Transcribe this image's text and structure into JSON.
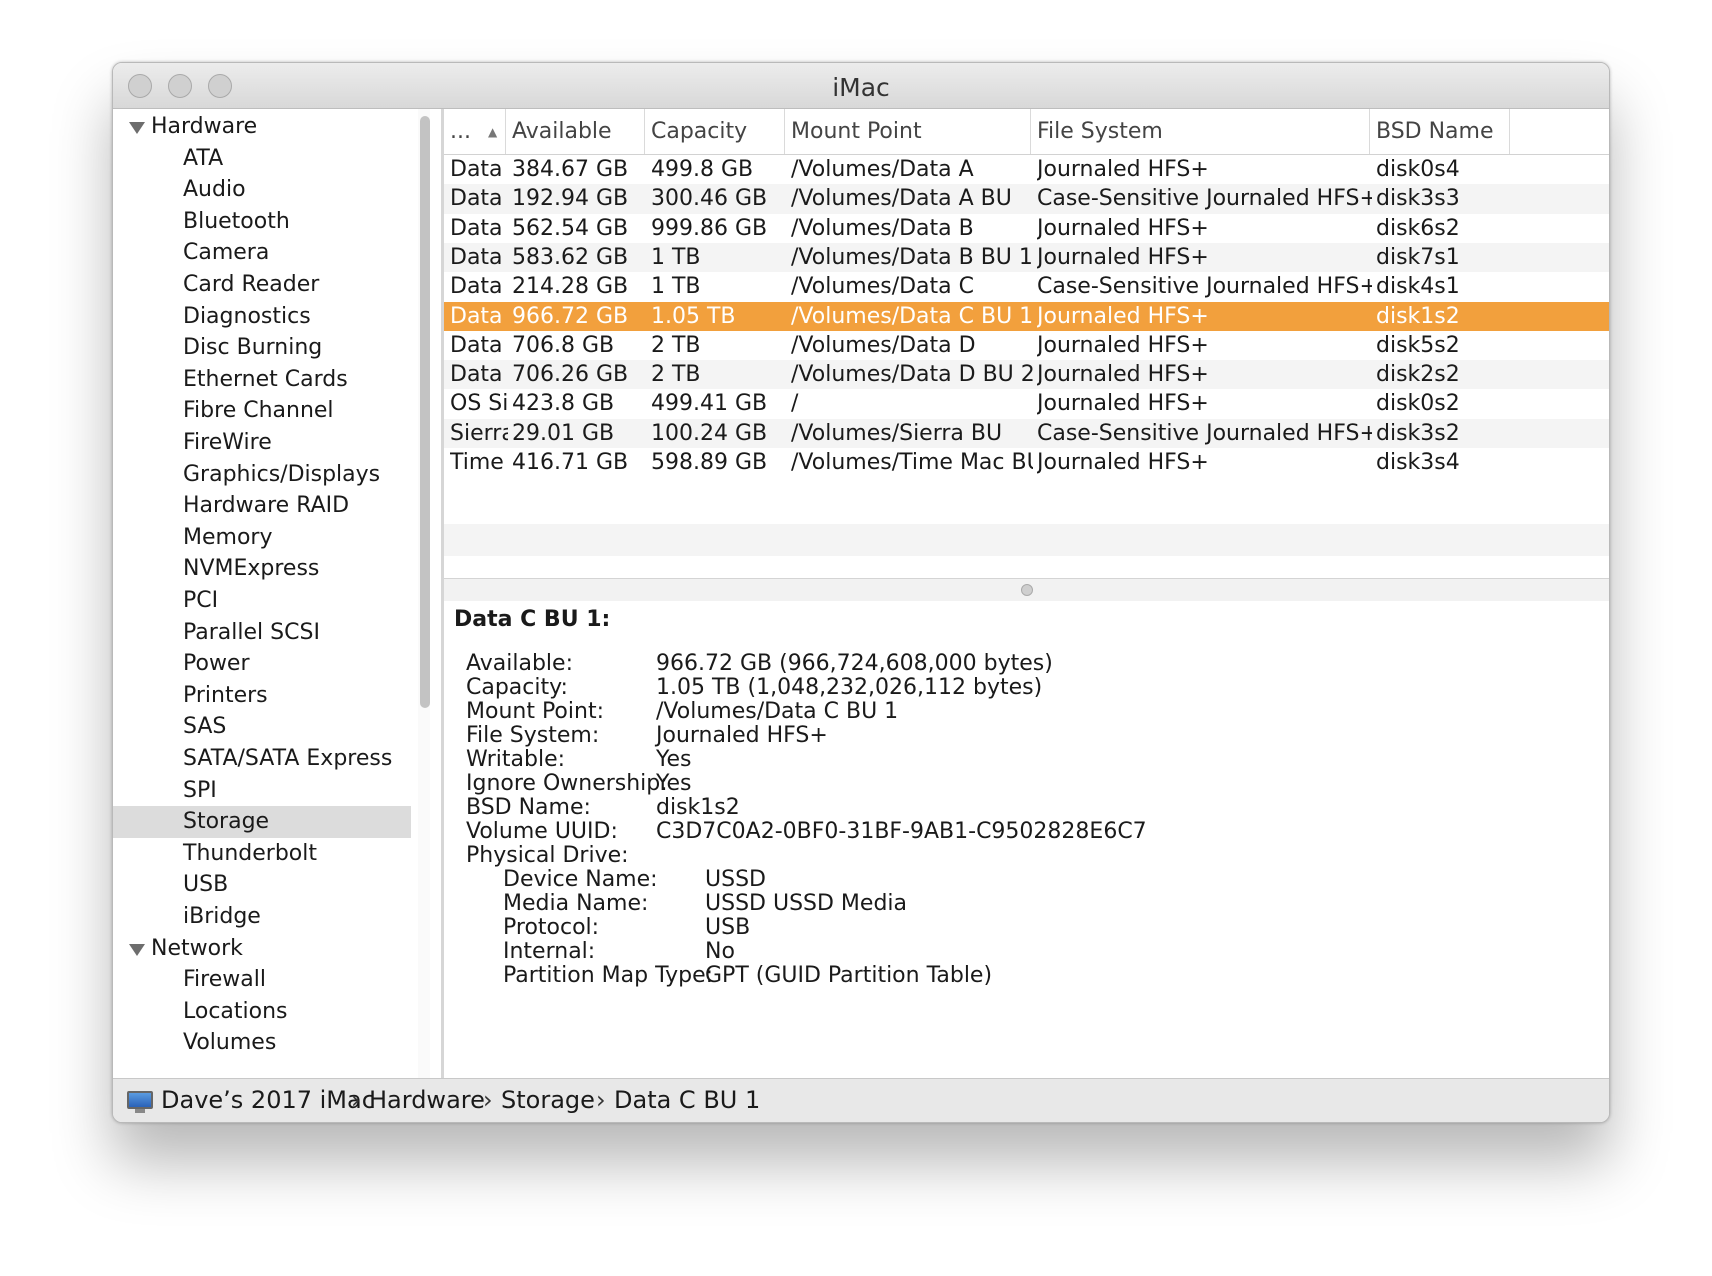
{
  "window": {
    "title": "iMac"
  },
  "sidebar": {
    "groups": [
      {
        "label": "Hardware",
        "items": [
          "ATA",
          "Audio",
          "Bluetooth",
          "Camera",
          "Card Reader",
          "Diagnostics",
          "Disc Burning",
          "Ethernet Cards",
          "Fibre Channel",
          "FireWire",
          "Graphics/Displays",
          "Hardware RAID",
          "Memory",
          "NVMExpress",
          "PCI",
          "Parallel SCSI",
          "Power",
          "Printers",
          "SAS",
          "SATA/SATA Express",
          "SPI",
          "Storage",
          "Thunderbolt",
          "USB",
          "iBridge"
        ]
      },
      {
        "label": "Network",
        "items": [
          "Firewall",
          "Locations",
          "Volumes"
        ]
      }
    ],
    "selected": "Storage"
  },
  "table": {
    "columns": [
      "...",
      "Available",
      "Capacity",
      "Mount Point",
      "File System",
      "BSD Name"
    ],
    "rows": [
      [
        "Data",
        "384.67 GB",
        "499.8 GB",
        "/Volumes/Data A",
        "Journaled HFS+",
        "disk0s4"
      ],
      [
        "Data",
        "192.94 GB",
        "300.46 GB",
        "/Volumes/Data A BU",
        "Case-Sensitive Journaled HFS+",
        "disk3s3"
      ],
      [
        "Data",
        "562.54 GB",
        "999.86 GB",
        "/Volumes/Data B",
        "Journaled HFS+",
        "disk6s2"
      ],
      [
        "Data",
        "583.62 GB",
        "1 TB",
        "/Volumes/Data B BU 1",
        "Journaled HFS+",
        "disk7s1"
      ],
      [
        "Data",
        "214.28 GB",
        "1 TB",
        "/Volumes/Data C",
        "Case-Sensitive Journaled HFS+",
        "disk4s1"
      ],
      [
        "Data",
        "966.72 GB",
        "1.05 TB",
        "/Volumes/Data C BU 1",
        "Journaled HFS+",
        "disk1s2"
      ],
      [
        "Data",
        "706.8 GB",
        "2 TB",
        "/Volumes/Data D",
        "Journaled HFS+",
        "disk5s2"
      ],
      [
        "Data",
        "706.26 GB",
        "2 TB",
        "/Volumes/Data D BU 2",
        "Journaled HFS+",
        "disk2s2"
      ],
      [
        "OS Si",
        "423.8 GB",
        "499.41 GB",
        "/",
        "Journaled HFS+",
        "disk0s2"
      ],
      [
        "Sierra",
        "29.01 GB",
        "100.24 GB",
        "/Volumes/Sierra BU",
        "Case-Sensitive Journaled HFS+",
        "disk3s2"
      ],
      [
        "Time",
        "416.71 GB",
        "598.89 GB",
        "/Volumes/Time Mac BU",
        "Journaled HFS+",
        "disk3s4"
      ]
    ],
    "selected_row": 5
  },
  "detail": {
    "title": "Data C BU 1:",
    "fields": [
      [
        "Available:",
        "966.72 GB (966,724,608,000 bytes)"
      ],
      [
        "Capacity:",
        "1.05 TB (1,048,232,026,112 bytes)"
      ],
      [
        "Mount Point:",
        "/Volumes/Data C BU 1"
      ],
      [
        "File System:",
        "Journaled HFS+"
      ],
      [
        "Writable:",
        "Yes"
      ],
      [
        "Ignore Ownership:",
        "Yes"
      ],
      [
        "BSD Name:",
        "disk1s2"
      ],
      [
        "Volume UUID:",
        "C3D7C0A2-0BF0-31BF-9AB1-C9502828E6C7"
      ],
      [
        "Physical Drive:",
        ""
      ]
    ],
    "physical_drive": [
      [
        "Device Name:",
        "USSD"
      ],
      [
        "Media Name:",
        "USSD USSD Media"
      ],
      [
        "Protocol:",
        "USB"
      ],
      [
        "Internal:",
        "No"
      ],
      [
        "Partition Map Type:",
        "GPT (GUID Partition Table)"
      ]
    ]
  },
  "pathbar": {
    "icon": "imac-icon",
    "crumbs": [
      "Dave’s 2017 iMac",
      "Hardware",
      "Storage",
      "Data C BU 1"
    ],
    "separator": "›"
  }
}
